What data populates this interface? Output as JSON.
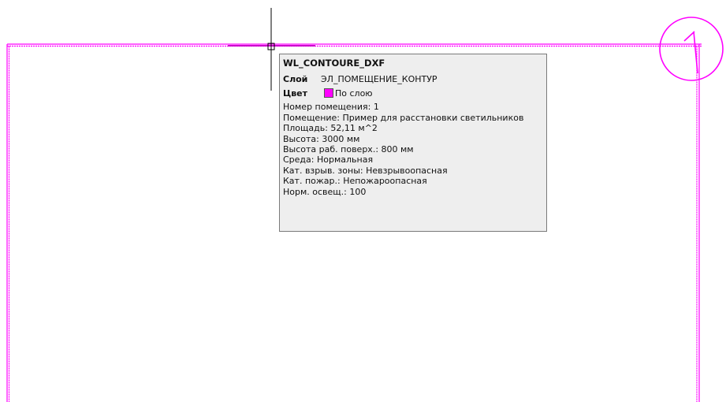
{
  "colors": {
    "contour": "#ff00ff",
    "crosshair": "#000000",
    "tooltip_bg": "#eeeeee",
    "tooltip_border": "#7a7a7a",
    "background": "#ffffff"
  },
  "tooltip": {
    "title": "WL_CONTOURE_DXF",
    "layer_key": "Слой",
    "layer_value": "ЭЛ_ПОМЕЩЕНИЕ_КОНТУР",
    "color_key": "Цвет",
    "color_value": "По слою",
    "properties": [
      "Номер помещения: 1",
      "Помещение: Пример для расстановки светильников",
      "Площадь: 52,11 м^2",
      "Высота: 3000 мм",
      "Высота раб. поверх.: 800 мм",
      "Среда: Нормальная",
      "Кат. взрыв. зоны: Невзрывоопасная",
      "Кат. пожар.: Непожароопасная",
      "Норм. освещ.: 100"
    ]
  },
  "axis_marker": {
    "label": "1"
  }
}
